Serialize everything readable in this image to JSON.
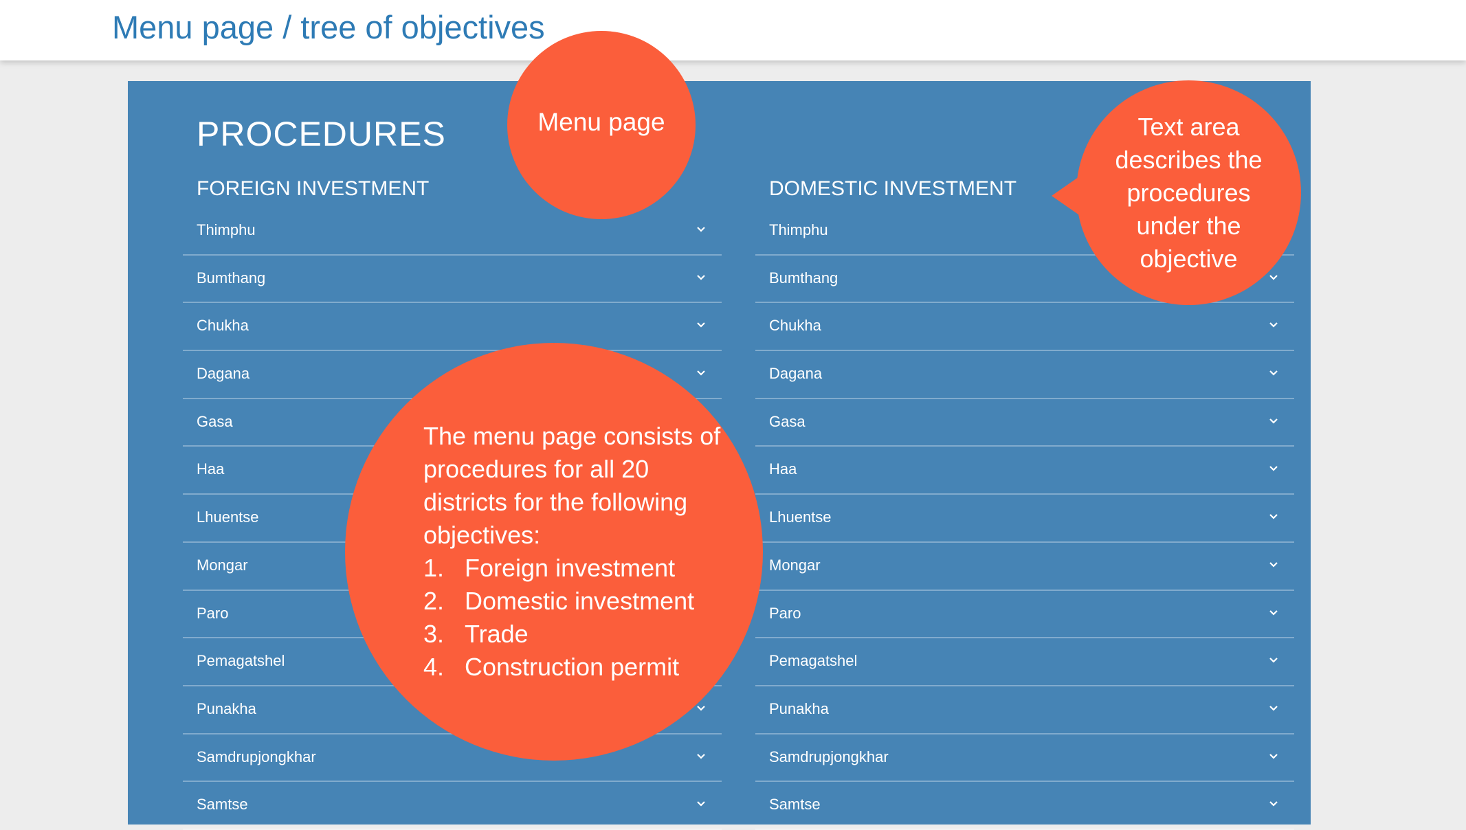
{
  "slide": {
    "title": "Menu page / tree of objectives"
  },
  "panel": {
    "title": "PROCEDURES",
    "columns": [
      {
        "heading": "FOREIGN INVESTMENT",
        "items": [
          "Thimphu",
          "Bumthang",
          "Chukha",
          "Dagana",
          "Gasa",
          "Haa",
          "Lhuentse",
          "Mongar",
          "Paro",
          "Pemagatshel",
          "Punakha",
          "Samdrupjongkhar",
          "Samtse"
        ]
      },
      {
        "heading": "DOMESTIC INVESTMENT",
        "items": [
          "Thimphu",
          "Bumthang",
          "Chukha",
          "Dagana",
          "Gasa",
          "Haa",
          "Lhuentse",
          "Mongar",
          "Paro",
          "Pemagatshel",
          "Punakha",
          "Samdrupjongkhar",
          "Samtse"
        ]
      }
    ]
  },
  "callouts": {
    "menu_page": "Menu page",
    "text_area": "Text area describes the procedures under the objective",
    "main": {
      "intro": "The menu page consists of procedures for all 20 districts for the following objectives:",
      "objectives": [
        {
          "num": "1.",
          "label": "Foreign investment"
        },
        {
          "num": "2.",
          "label": "Domestic investment"
        },
        {
          "num": "3.",
          "label": "Trade"
        },
        {
          "num": "4.",
          "label": "Construction permit"
        }
      ]
    }
  },
  "icons": {
    "row_expand": "chevron-down-icon"
  },
  "colors": {
    "panel_blue": "#4684b5",
    "title_blue": "#2e7bb5",
    "callout_orange": "#fb5e3b"
  }
}
